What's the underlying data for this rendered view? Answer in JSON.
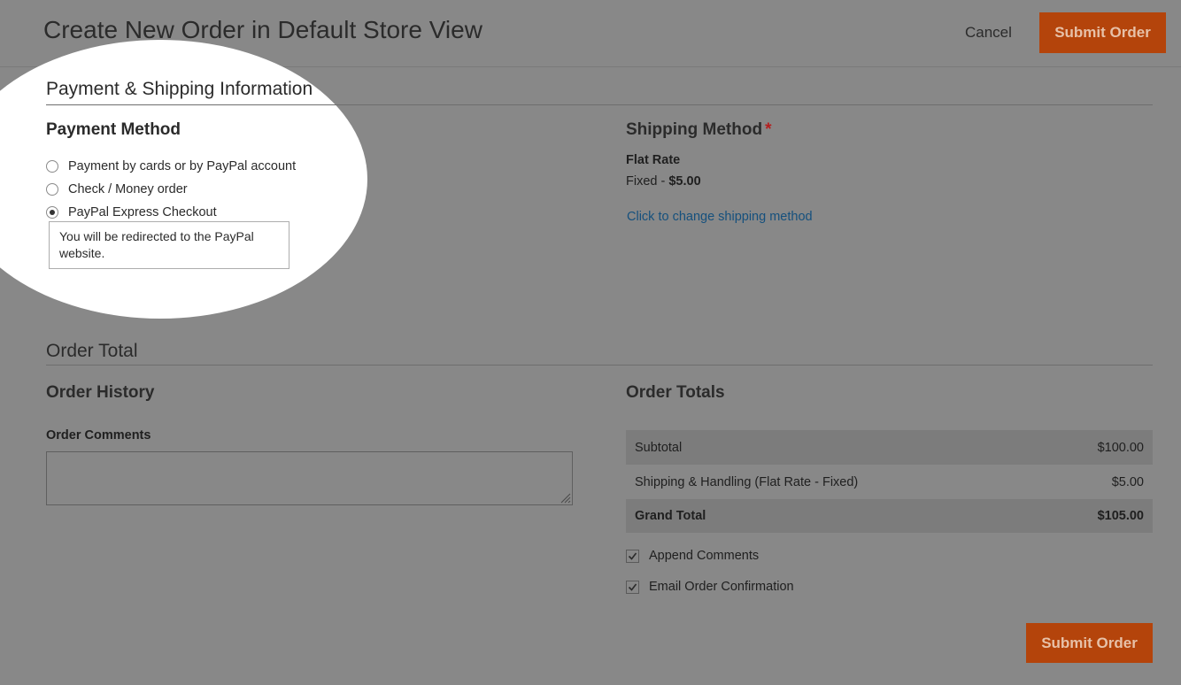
{
  "header": {
    "title": "Create New Order in Default Store View",
    "cancel_label": "Cancel",
    "submit_label": "Submit Order"
  },
  "payment_shipping": {
    "section_title": "Payment & Shipping Information",
    "payment": {
      "title": "Payment Method",
      "options": [
        {
          "label": "Payment by cards or by PayPal account",
          "selected": false
        },
        {
          "label": "Check / Money order",
          "selected": false
        },
        {
          "label": "PayPal Express Checkout",
          "selected": true
        }
      ],
      "redirect_note": "You will be redirected to the PayPal website."
    },
    "shipping": {
      "title": "Shipping Method",
      "required_mark": "*",
      "carrier": "Flat Rate",
      "method_label": "Fixed - ",
      "method_price": "$5.00",
      "change_link": "Click to change shipping method"
    }
  },
  "order_total": {
    "section_title": "Order Total",
    "history": {
      "title": "Order History",
      "comments_label": "Order Comments",
      "comments_value": ""
    },
    "totals": {
      "title": "Order Totals",
      "rows": [
        {
          "label": "Subtotal",
          "value": "$100.00"
        },
        {
          "label": "Shipping & Handling (Flat Rate - Fixed)",
          "value": "$5.00"
        },
        {
          "label": "Grand Total",
          "value": "$105.00"
        }
      ]
    },
    "options": {
      "append_comments": {
        "label": "Append Comments",
        "checked": true
      },
      "email_confirmation": {
        "label": "Email Order Confirmation",
        "checked": true
      }
    },
    "submit_label": "Submit Order"
  },
  "colors": {
    "overlay": "#888888",
    "accent_button": "#b4440b",
    "link": "#15507d",
    "required": "#b41e1e"
  }
}
